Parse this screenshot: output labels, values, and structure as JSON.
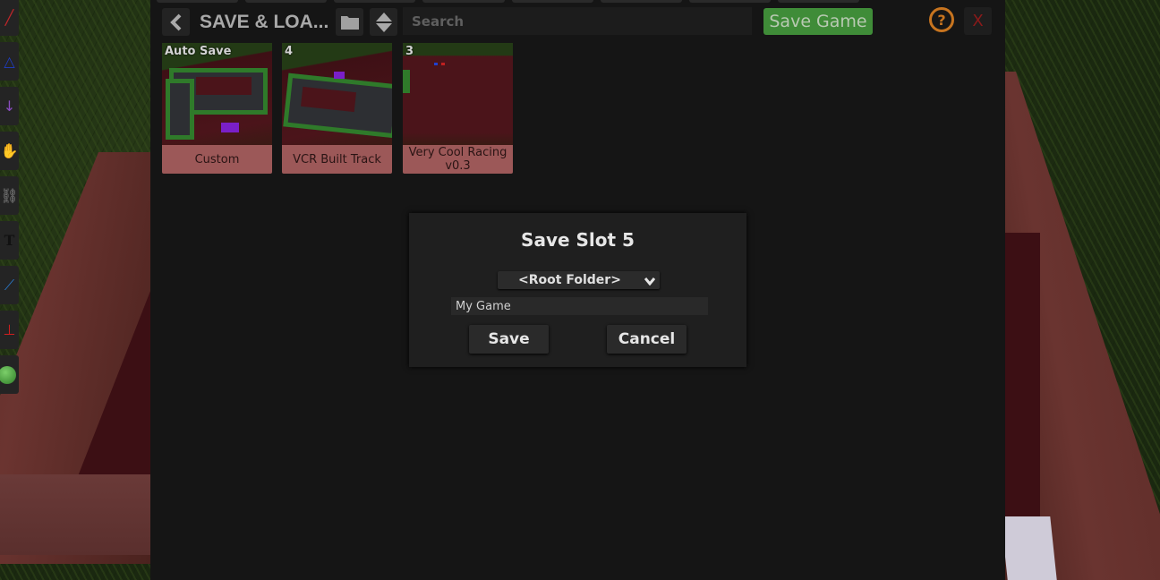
{
  "header": {
    "title": "SAVE & LOA...",
    "search_placeholder": "Search",
    "save_game_label": "Save Game",
    "help_label": "?",
    "close_label": "X",
    "icons": {
      "back": "chevron-left-icon",
      "folder": "folder-icon",
      "sort": "sort-up-down-icon"
    }
  },
  "toolbar": {
    "tools": [
      {
        "name": "pen-tool",
        "icon": "pen-icon",
        "color": "#c0262a"
      },
      {
        "name": "gizmo-tool",
        "icon": "shape-icon",
        "color": "#1f3dc4"
      },
      {
        "name": "line-drop-tool",
        "icon": "line-arrow-icon",
        "color": "#8a4cc0"
      },
      {
        "name": "grab-tool",
        "icon": "hand-icon",
        "color": "#dddddd"
      },
      {
        "name": "joint-tool",
        "icon": "chain-icon",
        "color": "#888888"
      },
      {
        "name": "text-tool",
        "icon": "text-icon",
        "color": "#111111"
      },
      {
        "name": "measure-tool",
        "icon": "measure-icon",
        "color": "#2a78c8"
      },
      {
        "name": "snap-tool",
        "icon": "pin-icon",
        "color": "#d21e1e"
      },
      {
        "name": "ball-tool",
        "icon": "ball-icon",
        "color": "#3e9b35"
      }
    ]
  },
  "slots": [
    {
      "number": "Auto Save",
      "name": "Custom"
    },
    {
      "number": "4",
      "name": "VCR Built Track"
    },
    {
      "number": "3",
      "name": "Very Cool Racing v0.3"
    }
  ],
  "dialog": {
    "title": "Save Slot 5",
    "folder_selected": "<Root Folder>",
    "name_value": "My Game",
    "save_label": "Save",
    "cancel_label": "Cancel"
  },
  "colors": {
    "save_green": "#3f8c38",
    "help_orange": "#c7741f",
    "close_red": "#8a1a1a",
    "slot_label_bg": "#9c5858"
  }
}
